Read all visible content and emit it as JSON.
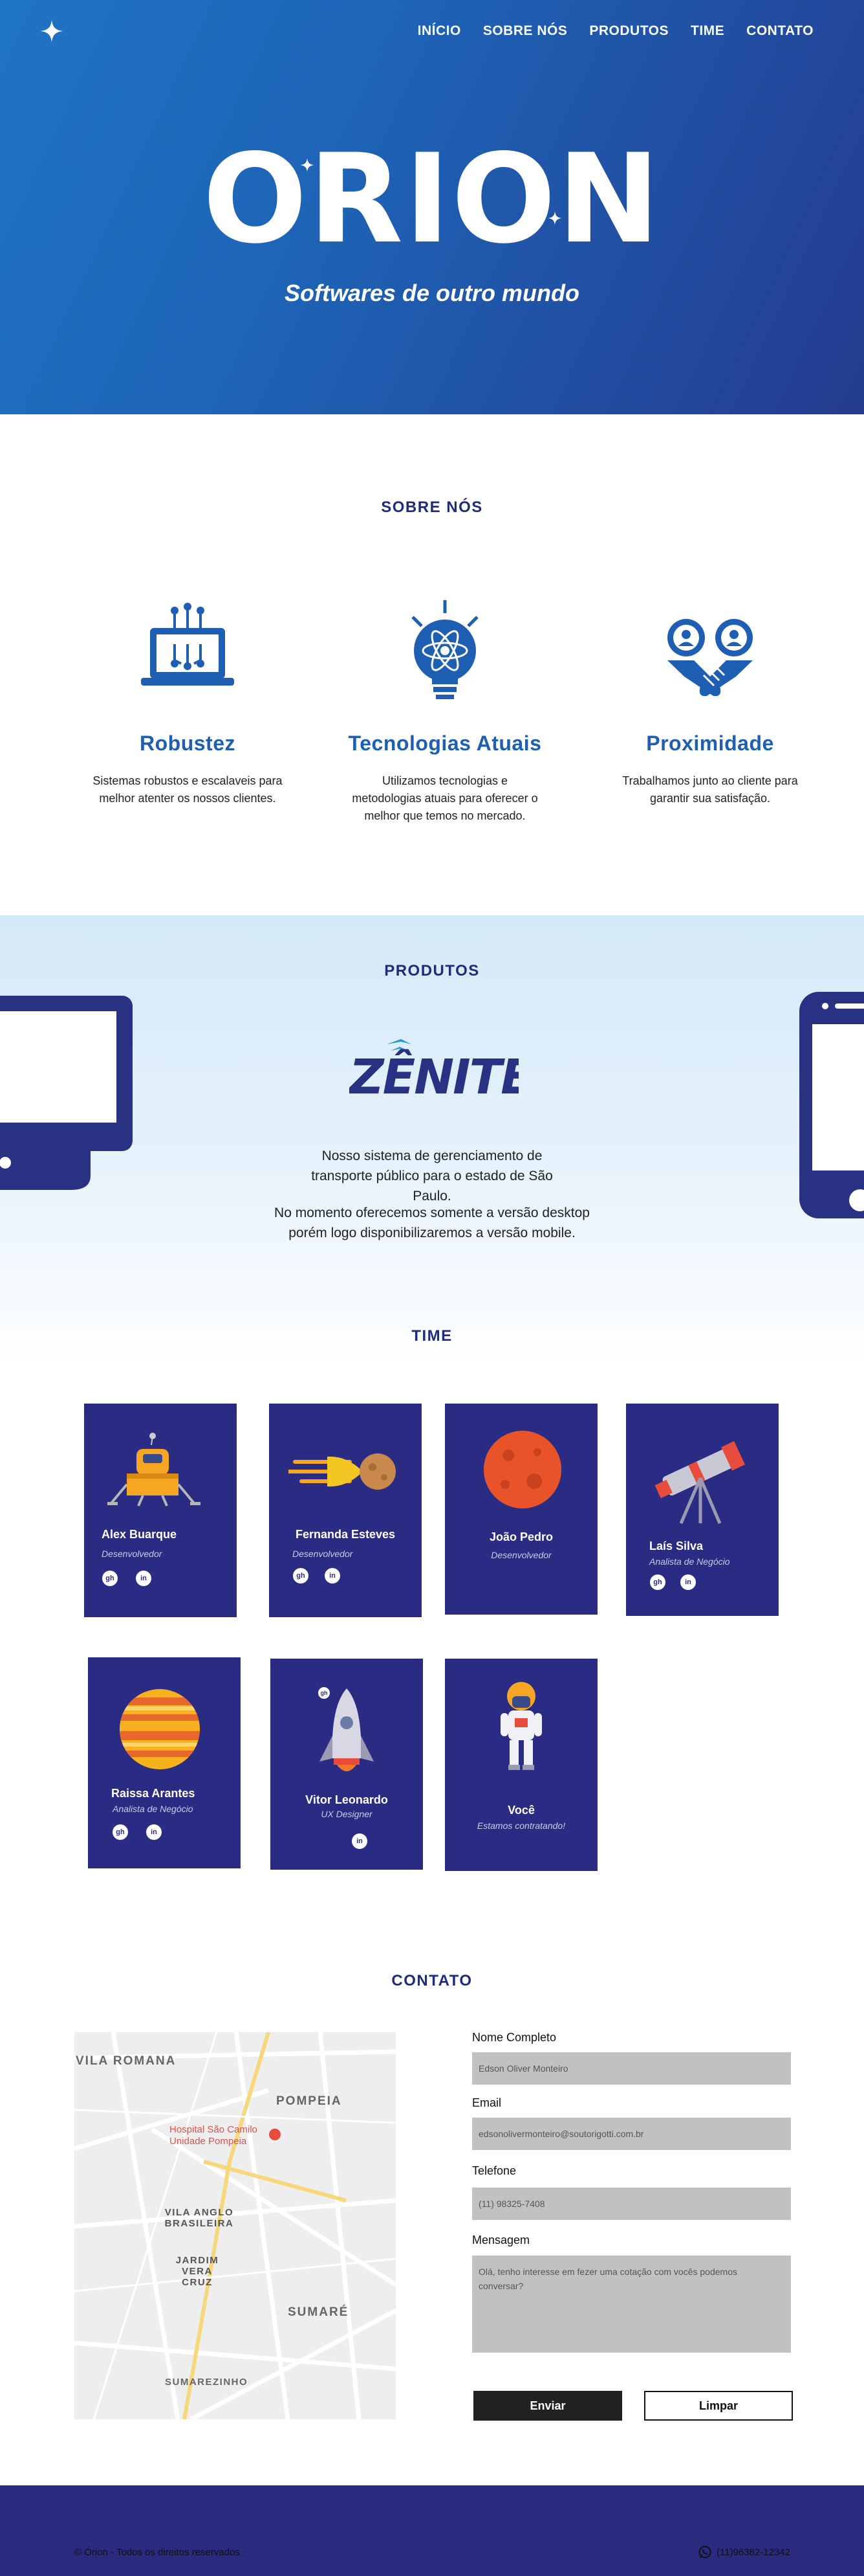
{
  "nav": {
    "items": [
      "INÍCIO",
      "SOBRE NÓS",
      "PRODUTOS",
      "TIME",
      "CONTATO"
    ]
  },
  "hero": {
    "brand": "ORION",
    "subtitle": "Softwares de outro mundo"
  },
  "sobre": {
    "title": "SOBRE NÓS",
    "features": [
      {
        "icon": "laptop-circuit-icon",
        "title": "Robustez",
        "text": "Sistemas robustos e escalaveis para melhor atenter os nossos clientes."
      },
      {
        "icon": "lightbulb-atom-icon",
        "title": "Tecnologias Atuais",
        "text": "Utilizamos tecnologias e metodologias atuais para oferecer o melhor que temos no mercado."
      },
      {
        "icon": "handshake-icon",
        "title": "Proximidade",
        "text": "Trabalhamos junto ao cliente para garantir sua satisfação."
      }
    ]
  },
  "produtos": {
    "title": "PRODUTOS",
    "product_name": "ZÊNITE",
    "text1": "Nosso sistema de gerenciamento de transporte público para o estado de São Paulo.",
    "text2": "No momento oferecemos somente a versão desktop porém logo disponibilizaremos a versão mobile."
  },
  "time": {
    "title": "TIME",
    "members": [
      {
        "name": "Alex Buarque",
        "role": "Desenvolvedor",
        "icon": "lunar-lander-icon",
        "links": [
          "github",
          "linkedin"
        ]
      },
      {
        "name": "Fernanda Esteves",
        "role": "Desenvolvedor",
        "icon": "meteor-icon",
        "links": [
          "github",
          "linkedin"
        ]
      },
      {
        "name": "João Pedro",
        "role": "Desenvolvedor",
        "icon": "mars-planet-icon",
        "links": []
      },
      {
        "name": "Laís Silva",
        "role": "Analista de Negócio",
        "icon": "telescope-icon",
        "links": [
          "github",
          "linkedin"
        ]
      },
      {
        "name": "Raissa Arantes",
        "role": "Analista de Negócio",
        "icon": "jupiter-planet-icon",
        "links": [
          "github",
          "linkedin"
        ]
      },
      {
        "name": "Vitor Leonardo",
        "role": "UX Designer",
        "icon": "rocket-icon",
        "links": [
          "github",
          "linkedin"
        ]
      },
      {
        "name": "Você",
        "role": "Estamos contratando!",
        "icon": "astronaut-icon",
        "links": []
      }
    ]
  },
  "contato": {
    "title": "CONTATO",
    "map_labels": [
      "VILA ROMANA",
      "POMPEIA",
      "Hospital São Camilo",
      "Unidade Pompeia",
      "VILA ANGLO BRASILEIRA",
      "JARDIM VERA CRUZ",
      "SUMARÉ",
      "SUMAREZINHO"
    ],
    "fields": [
      {
        "label": "Nome Completo",
        "value": "Edson Oliver Monteiro"
      },
      {
        "label": "Email",
        "value": "edsonolivermonteiro@soutorigotti.com.br"
      },
      {
        "label": "Telefone",
        "value": "(11) 98325-7408"
      },
      {
        "label": "Mensagem",
        "value": "Olá, tenho interesse em fezer uma cotação com vocês podemos conversar?"
      }
    ],
    "send_label": "Enviar",
    "clear_label": "Limpar"
  },
  "footer": {
    "copyright": "© Órion - Todos os direitos reservados",
    "phone": "(11)96382-12342"
  }
}
